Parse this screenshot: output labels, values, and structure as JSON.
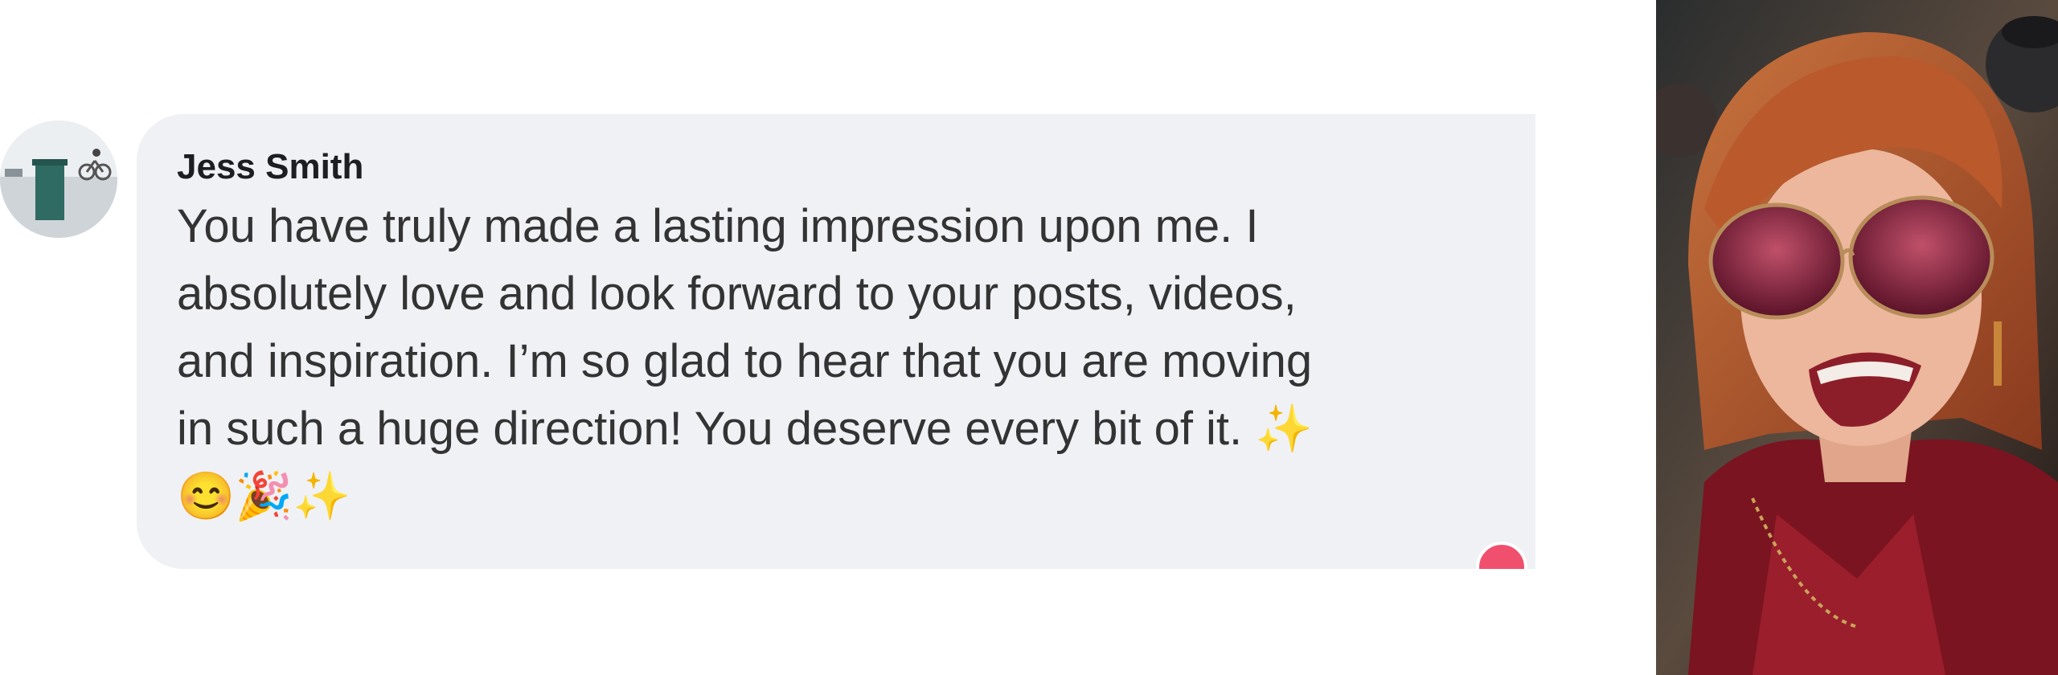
{
  "comment": {
    "author": "Jess Smith",
    "text": "You have truly made a lasting impression upon me. I\nabsolutely love and look forward to your posts, videos,\nand inspiration. I’m so glad to hear that you are moving\nin such a huge direction! You deserve every bit of it. ✨\n😊🎉✨",
    "avatar_icon": "profile-avatar",
    "reaction_icon": "heart-reaction-icon"
  },
  "colors": {
    "bubble": "#eff1f5",
    "author_text": "#1c1e21",
    "body_text": "#333333",
    "reaction": "#f0506e"
  },
  "photo": {
    "icon": "profile-photo"
  }
}
